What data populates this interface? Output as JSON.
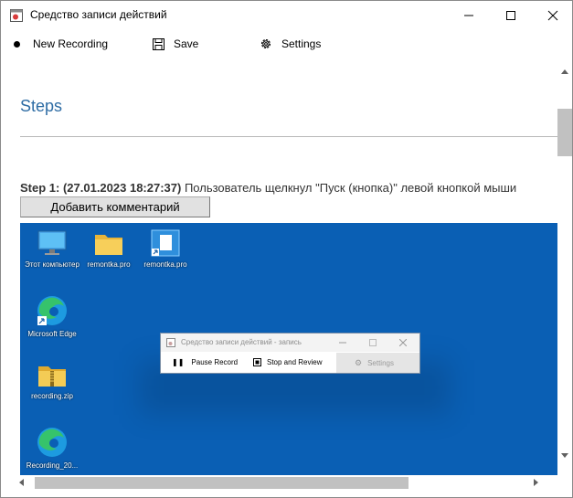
{
  "window": {
    "title": "Средство записи действий",
    "icons": [
      "app-icon",
      "minimize-icon",
      "maximize-icon",
      "close-icon"
    ]
  },
  "toolbar": {
    "new_recording": "New Recording",
    "save": "Save",
    "settings": "Settings"
  },
  "content": {
    "heading": "Steps",
    "step": {
      "label": "Step 1: (27.01.2023 18:27:37)",
      "description": " Пользователь щелкнул \"Пуск (кнопка)\" левой кнопкой мыши"
    },
    "add_comment": "Добавить комментарий"
  },
  "screenshot": {
    "desktop_color": "#0a5fb4",
    "icons": [
      {
        "label": "Этот компьютер",
        "icon": "computer-icon"
      },
      {
        "label": "remontka.pro",
        "icon": "folder-icon"
      },
      {
        "label": "remontka.pro",
        "icon": "shortcut-icon"
      },
      {
        "label": "Microsoft Edge",
        "icon": "edge-icon"
      },
      {
        "label": "recording.zip",
        "icon": "zip-icon"
      },
      {
        "label": "Recording_20...",
        "icon": "edge-icon"
      }
    ],
    "mini_window": {
      "title": "Средство записи действий - запись",
      "pause": "Pause Record",
      "stop": "Stop and Review",
      "settings": "Settings"
    }
  },
  "colors": {
    "heading": "#2e6ca4",
    "scroll_thumb": "#c1c1c1"
  }
}
